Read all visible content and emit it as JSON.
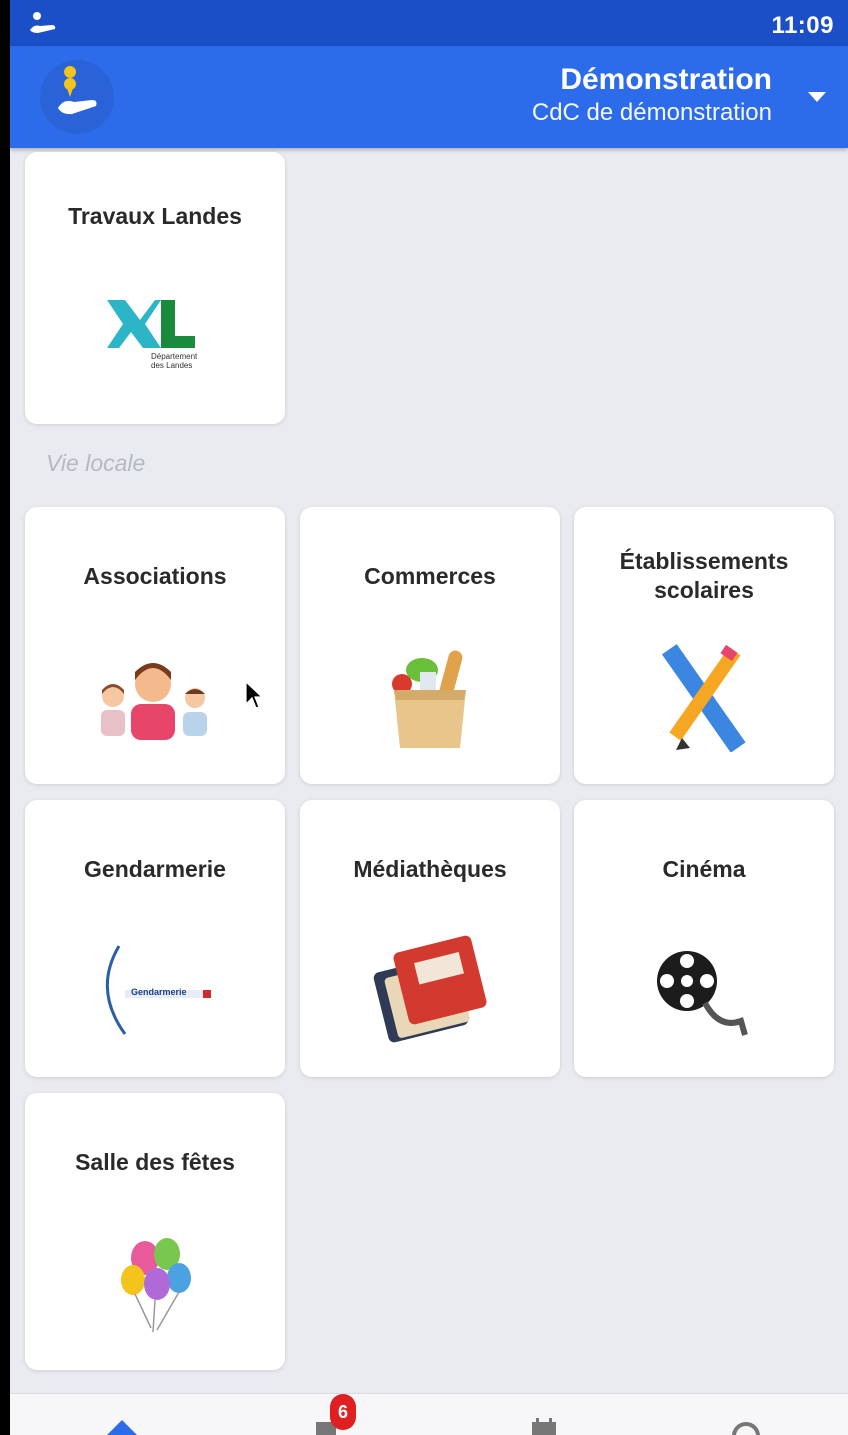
{
  "statusbar": {
    "time": "11:09",
    "app_icon": "hand-icon"
  },
  "appbar": {
    "title": "Démonstration",
    "subtitle": "CdC de démonstration",
    "logo_icon": "hand-pin-logo",
    "dropdown_icon": "caret-down-icon"
  },
  "cards_top": [
    {
      "label": "Travaux Landes",
      "icon": "xl-departement-landes-logo",
      "logo_caption": "Département des Landes"
    }
  ],
  "section_vie_locale": {
    "title": "Vie locale"
  },
  "cards": [
    {
      "label": "Associations",
      "icon": "people-icon"
    },
    {
      "label": "Commerces",
      "icon": "grocery-bag-icon"
    },
    {
      "label": "Établissements scolaires",
      "icon": "ruler-pencil-icon"
    },
    {
      "label": "Gendarmerie",
      "icon": "gendarmerie-logo",
      "logo_caption": "Gendarmerie"
    },
    {
      "label": "Médiathèques",
      "icon": "books-icon"
    },
    {
      "label": "Cinéma",
      "icon": "film-reel-icon"
    },
    {
      "label": "Salle des fêtes",
      "icon": "balloons-icon"
    }
  ],
  "bottom_nav": {
    "items": [
      {
        "icon": "home-icon"
      },
      {
        "icon": "news-icon",
        "badge": "6"
      },
      {
        "icon": "calendar-icon"
      },
      {
        "icon": "settings-icon"
      }
    ]
  },
  "colors": {
    "statusbar": "#1a4fc7",
    "appbar": "#2c6be9",
    "background": "#e9ebf0",
    "badge": "#e02020"
  }
}
